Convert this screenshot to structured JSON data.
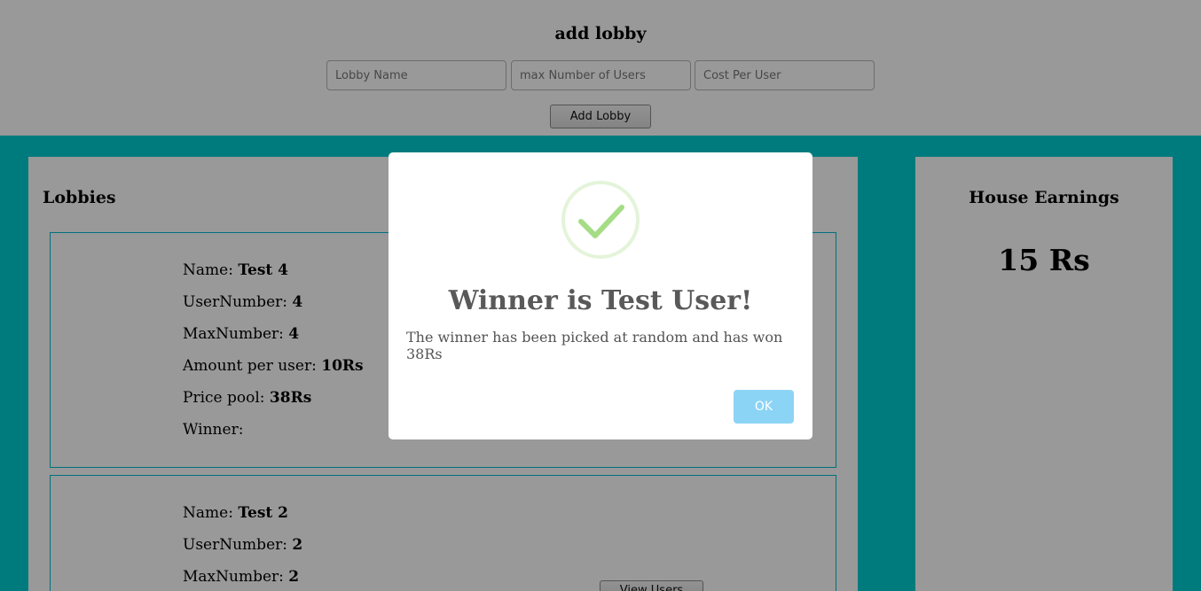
{
  "header": {
    "title": "add lobby",
    "lobby_name_placeholder": "Lobby Name",
    "max_users_placeholder": "max Number of Users",
    "cost_placeholder": "Cost Per User",
    "add_button": "Add Lobby"
  },
  "lobbies": {
    "title": "Lobbies",
    "items": [
      {
        "name_label": "Name:",
        "name": "Test 4",
        "user_number_label": "UserNumber:",
        "user_number": "4",
        "max_number_label": "MaxNumber:",
        "max_number": "4",
        "amount_label": "Amount per user:",
        "amount": "10Rs",
        "pool_label": "Price pool:",
        "pool": "38Rs",
        "winner_label": "Winner:",
        "winner": ""
      },
      {
        "name_label": "Name:",
        "name": "Test 2",
        "user_number_label": "UserNumber:",
        "user_number": "2",
        "max_number_label": "MaxNumber:",
        "max_number": "2"
      }
    ],
    "view_button": "View Users"
  },
  "earnings": {
    "title": "House Earnings",
    "value": "15 Rs"
  },
  "modal": {
    "icon": "checkmark-success-icon",
    "title": "Winner is Test User!",
    "text": "The winner has been picked at random and has won 38Rs",
    "ok_button": "OK"
  },
  "colors": {
    "accent": "#00ced1",
    "success": "#a5dc86",
    "confirm": "#8cd4f5"
  }
}
